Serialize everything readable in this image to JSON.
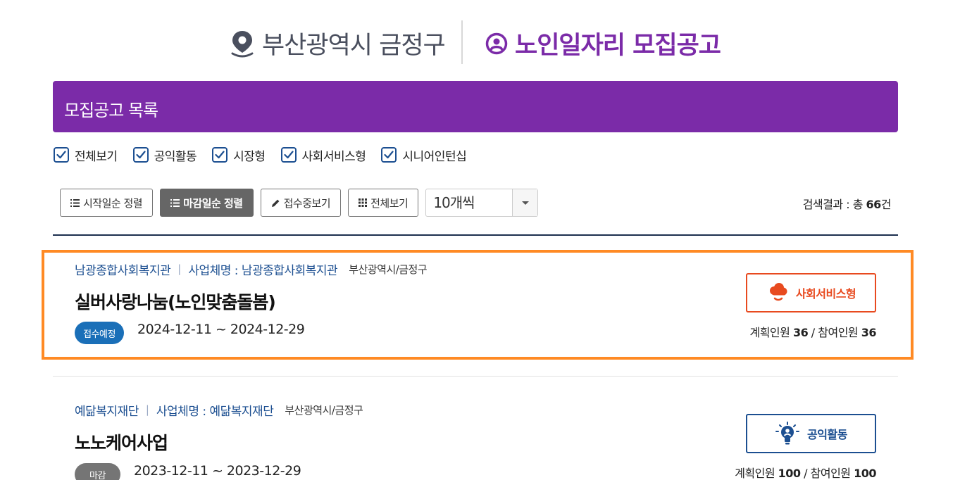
{
  "header": {
    "region": "부산광역시 금정구",
    "title": "노인일자리 모집공고"
  },
  "list_header": "모집공고 목록",
  "filters": [
    {
      "label": "전체보기",
      "checked": true
    },
    {
      "label": "공익활동",
      "checked": true
    },
    {
      "label": "시장형",
      "checked": true
    },
    {
      "label": "사회서비스형",
      "checked": true
    },
    {
      "label": "시니어인턴십",
      "checked": true
    }
  ],
  "toolbar": {
    "sort_start": "시작일순 정렬",
    "sort_end": "마감일순 정렬",
    "view_receiving": "접수중보기",
    "view_all": "전체보기",
    "per_page": "10개씩"
  },
  "result": {
    "prefix": "검색결과 : 총 ",
    "count": "66",
    "suffix": "건"
  },
  "postings": [
    {
      "org": "남광종합사회복지관",
      "business": "사업체명 : 남광종합사회복지관",
      "region": "부산광역시/금정구",
      "title": "실버사랑나눔(노인맞춤돌봄)",
      "status": "접수예정",
      "status_color": "#1a6fb8",
      "period": "2024-12-11 ~ 2024-12-29",
      "type": "사회서비스형",
      "type_color": "#e84a1f",
      "type_icon": "cloud-heart-icon",
      "planned_label": "계획인원 ",
      "planned": "36",
      "participants_label": " / 참여인원 ",
      "participants": "36"
    },
    {
      "org": "예닮복지재단",
      "business": "사업체명 : 예닮복지재단",
      "region": "부산광역시/금정구",
      "title": "노노케어사업",
      "status": "마감",
      "status_color": "#757575",
      "period": "2023-12-11 ~ 2023-12-29",
      "type": "공익활동",
      "type_color": "#1c4f91",
      "type_icon": "lightbulb-person-icon",
      "planned_label": "계획인원 ",
      "planned": "100",
      "participants_label": " / 참여인원 ",
      "participants": "100"
    }
  ]
}
